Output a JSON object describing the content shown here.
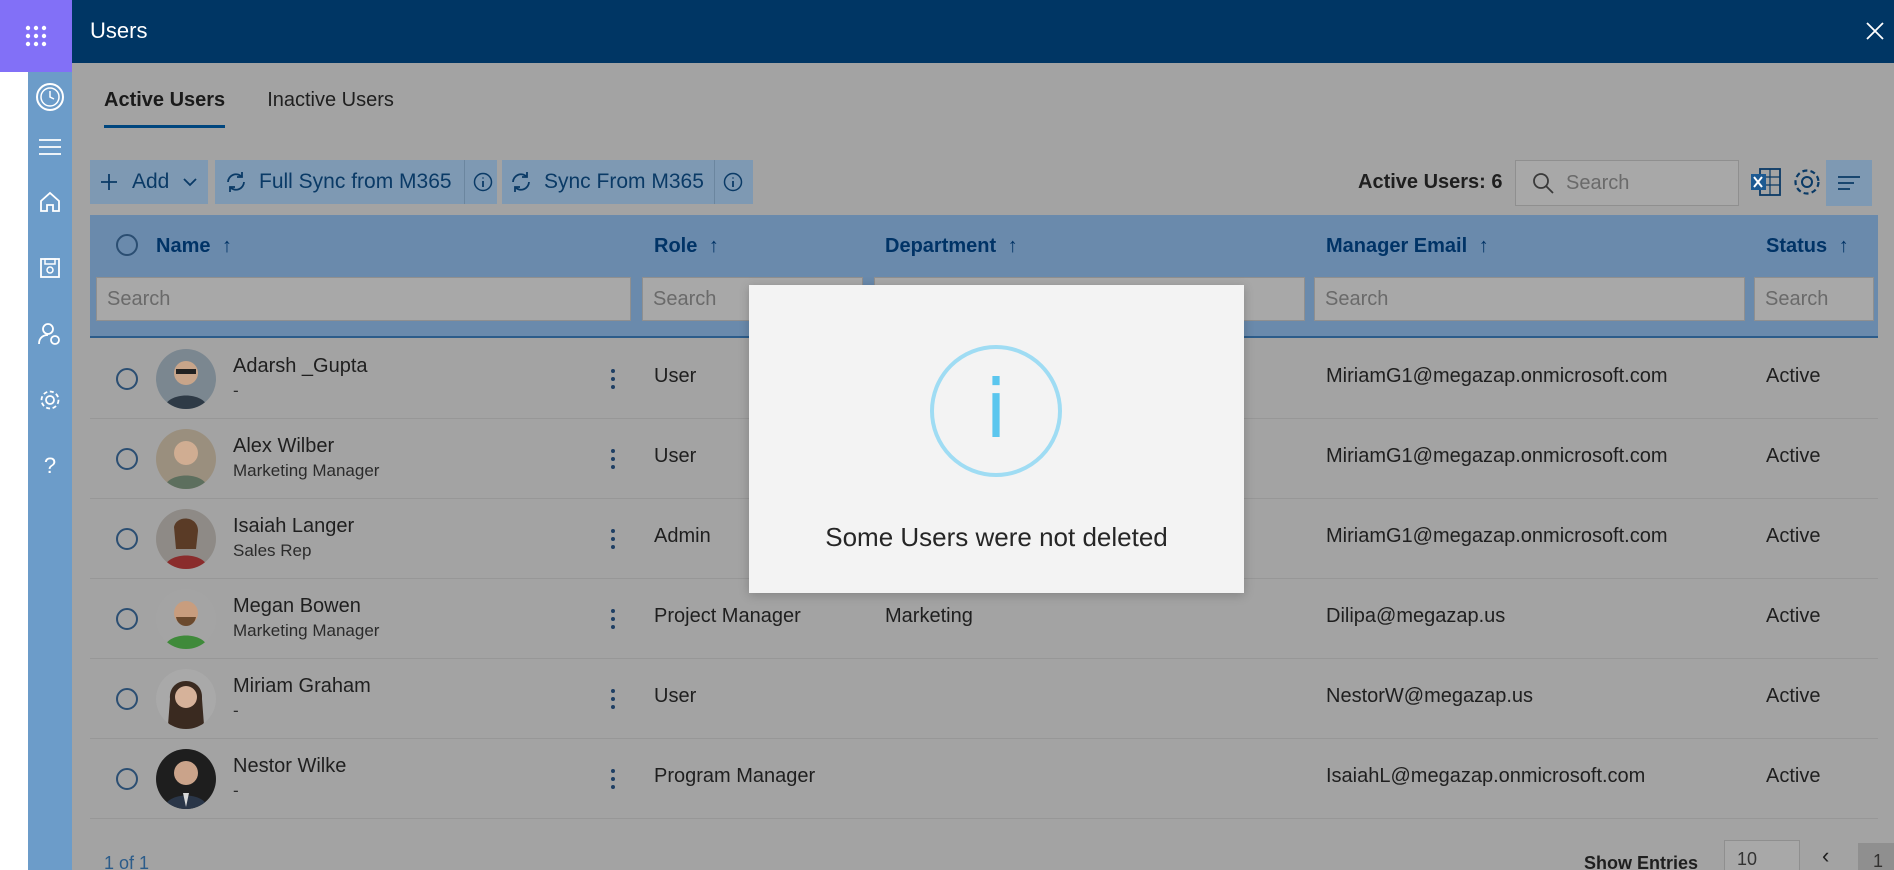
{
  "app": {
    "title": "Users"
  },
  "tabs": [
    {
      "label": "Active Users",
      "active": true
    },
    {
      "label": "Inactive Users",
      "active": false
    }
  ],
  "toolbar": {
    "add_label": "Add",
    "full_sync_label": "Full Sync from M365",
    "sync_label": "Sync From M365",
    "active_count_label": "Active Users: 6",
    "search_placeholder": "Search"
  },
  "table": {
    "columns": [
      {
        "label": "Name",
        "sort": "↑"
      },
      {
        "label": "Role",
        "sort": "↑"
      },
      {
        "label": "Department",
        "sort": "↑"
      },
      {
        "label": "Manager Email",
        "sort": "↑"
      },
      {
        "label": "Status",
        "sort": "↑"
      }
    ],
    "filter_placeholder": "Search",
    "rows": [
      {
        "name": "Adarsh _Gupta",
        "title": "-",
        "role": "User",
        "department": "",
        "manager_email": "MiriamG1@megazap.onmicrosoft.com",
        "status": "Active"
      },
      {
        "name": "Alex Wilber",
        "title": "Marketing Manager",
        "role": "User",
        "department": "",
        "manager_email": "MiriamG1@megazap.onmicrosoft.com",
        "status": "Active"
      },
      {
        "name": "Isaiah Langer",
        "title": "Sales Rep",
        "role": "Admin",
        "department": "",
        "manager_email": "MiriamG1@megazap.onmicrosoft.com",
        "status": "Active"
      },
      {
        "name": "Megan Bowen",
        "title": "Marketing Manager",
        "role": "Project Manager",
        "department": "Marketing",
        "manager_email": "Dilipa@megazap.us",
        "status": "Active"
      },
      {
        "name": "Miriam Graham",
        "title": "-",
        "role": "User",
        "department": "",
        "manager_email": "NestorW@megazap.us",
        "status": "Active"
      },
      {
        "name": "Nestor Wilke",
        "title": "-",
        "role": "Program Manager",
        "department": "",
        "manager_email": "IsaiahL@megazap.onmicrosoft.com",
        "status": "Active"
      }
    ]
  },
  "footer": {
    "range": "1 of 1",
    "show_entries": "Show Entries",
    "entries_value": "10",
    "page": "1"
  },
  "modal": {
    "icon_text": "i",
    "message": "Some Users were not deleted"
  },
  "colors": {
    "header": "#003664",
    "launcher": "#8270f7",
    "sidebar": "#6c9cc9",
    "modal_icon": "#9fdcf3",
    "info_icon_text": "#5bc6ee"
  },
  "icons": [
    "app-launcher-icon",
    "clock-icon",
    "hamburger-icon",
    "home-icon",
    "save-disk-icon",
    "user-settings-icon",
    "gear-icon",
    "help-icon",
    "close-icon",
    "plus-icon",
    "chevron-down-icon",
    "sync-icon",
    "info-icon",
    "search-icon",
    "excel-icon",
    "list-view-icon"
  ]
}
